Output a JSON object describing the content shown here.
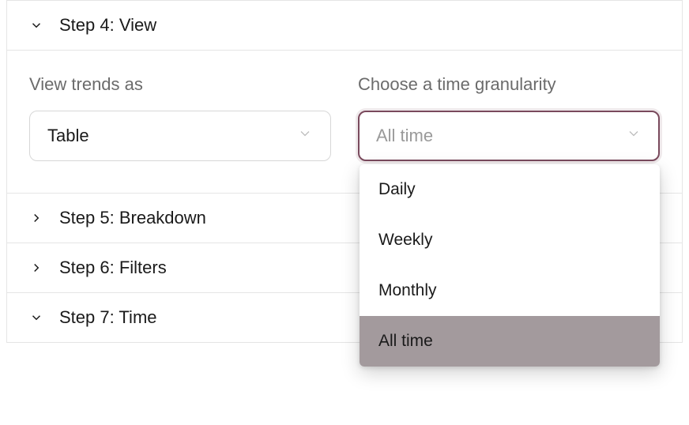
{
  "steps": {
    "view": {
      "title": "Step 4: View",
      "expanded": true
    },
    "breakdown": {
      "title": "Step 5: Breakdown",
      "expanded": false
    },
    "filters": {
      "title": "Step 6: Filters",
      "expanded": false
    },
    "time": {
      "title": "Step 7: Time",
      "expanded": true
    }
  },
  "viewTrends": {
    "label": "View trends as",
    "value": "Table"
  },
  "granularity": {
    "label": "Choose a time granularity",
    "placeholder": "All time",
    "open": true,
    "options": [
      {
        "label": "Daily"
      },
      {
        "label": "Weekly"
      },
      {
        "label": "Monthly"
      },
      {
        "label": "All time",
        "highlight": true
      }
    ]
  }
}
